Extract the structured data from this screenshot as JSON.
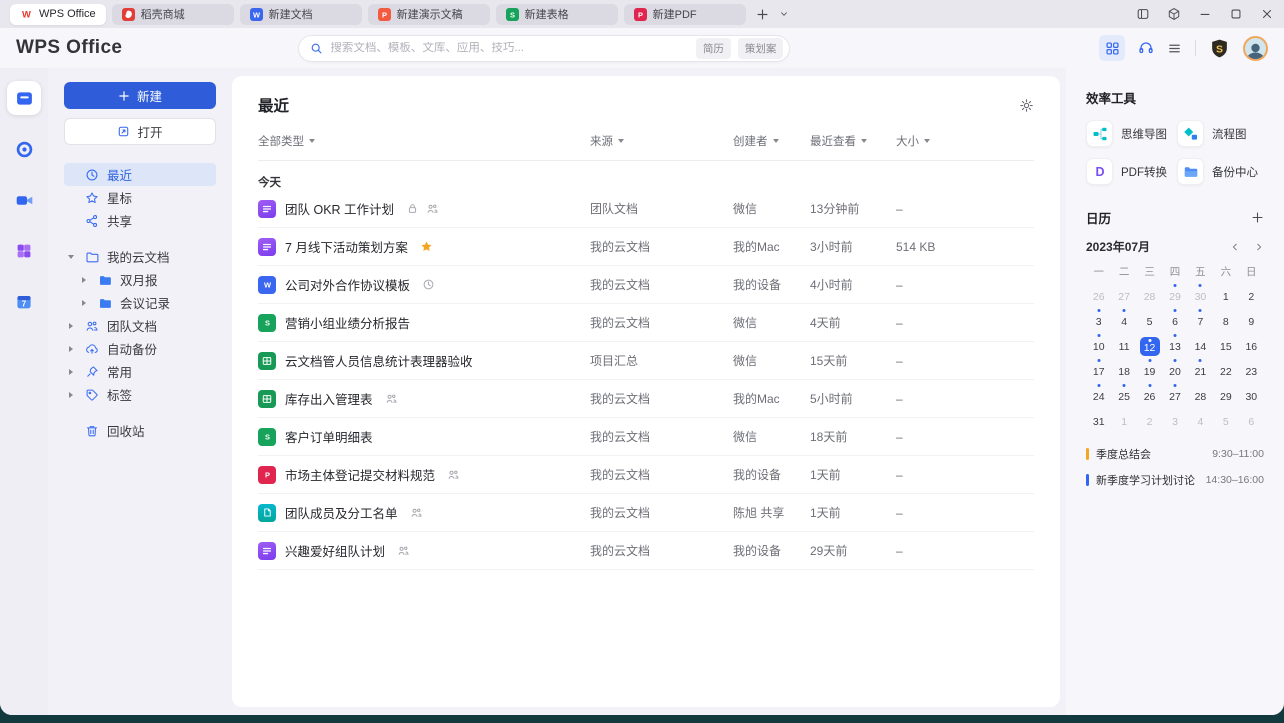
{
  "tabbar": {
    "tabs": [
      {
        "label": "WPS Office",
        "icon": "wps",
        "active": true
      },
      {
        "label": "稻壳商城",
        "icon": "docer",
        "active": false
      },
      {
        "label": "新建文档",
        "icon": "word",
        "active": false
      },
      {
        "label": "新建演示文稿",
        "icon": "ppt",
        "active": false
      },
      {
        "label": "新建表格",
        "icon": "sheet",
        "active": false
      },
      {
        "label": "新建PDF",
        "icon": "pdf",
        "active": false
      }
    ]
  },
  "header": {
    "logo": "WPS Office",
    "search": {
      "placeholder": "搜索文档、模板、文库、应用、技巧...",
      "tags": [
        "简历",
        "策划案"
      ]
    }
  },
  "sidebar": {
    "new_label": "新建",
    "open_label": "打开",
    "recent": "最近",
    "starred": "星标",
    "shared": "共享",
    "my_cloud": "我的云文档",
    "folder_bimonthly": "双月报",
    "folder_meetings": "会议记录",
    "team_docs": "团队文档",
    "auto_backup": "自动备份",
    "frequent": "常用",
    "tags_label": "标签",
    "trash": "回收站"
  },
  "main": {
    "title": "最近",
    "filters": {
      "type": "全部类型",
      "source": "来源",
      "creator": "创建者",
      "viewed": "最近查看",
      "size": "大小"
    },
    "group_today": "今天",
    "rows": [
      {
        "type": "otl",
        "name": "团队 OKR 工作计划",
        "badges": [
          "lock",
          "people"
        ],
        "source": "团队文档",
        "creator": "微信",
        "viewed": "13分钟前",
        "size": "–"
      },
      {
        "type": "otl",
        "name": "7 月线下活动策划方案",
        "badges": [
          "star"
        ],
        "source": "我的云文档",
        "creator": "我的Mac",
        "viewed": "3小时前",
        "size": "514 KB"
      },
      {
        "type": "word",
        "name": "公司对外合作协议模板",
        "badges": [
          "clock"
        ],
        "source": "我的云文档",
        "creator": "我的设备",
        "viewed": "4小时前",
        "size": "–"
      },
      {
        "type": "sheet-s",
        "name": "营销小组业绩分析报告",
        "badges": [],
        "source": "我的云文档",
        "creator": "微信",
        "viewed": "4天前",
        "size": "–"
      },
      {
        "type": "sheet-grid",
        "name": "云文档管人员信息统计表理器验收",
        "badges": [],
        "source": "项目汇总",
        "creator": "微信",
        "viewed": "15天前",
        "size": "–"
      },
      {
        "type": "sheet-grid",
        "name": "库存出入管理表",
        "badges": [
          "people"
        ],
        "source": "我的云文档",
        "creator": "我的Mac",
        "viewed": "5小时前",
        "size": "–"
      },
      {
        "type": "sheet-s",
        "name": "客户订单明细表",
        "badges": [],
        "source": "我的云文档",
        "creator": "微信",
        "viewed": "18天前",
        "size": "–"
      },
      {
        "type": "pdf",
        "name": "市场主体登记提交材料规范",
        "badges": [
          "people"
        ],
        "source": "我的云文档",
        "creator": "我的设备",
        "viewed": "1天前",
        "size": "–"
      },
      {
        "type": "smart",
        "name": "团队成员及分工名单",
        "badges": [
          "people"
        ],
        "source": "我的云文档",
        "creator": "陈旭 共享",
        "viewed": "1天前",
        "size": "–"
      },
      {
        "type": "otl",
        "name": "兴趣爱好组队计划",
        "badges": [
          "people"
        ],
        "source": "我的云文档",
        "creator": "我的设备",
        "viewed": "29天前",
        "size": "–"
      }
    ]
  },
  "tools": {
    "title": "效率工具",
    "items": [
      {
        "label": "思维导图",
        "icon": "mindmap"
      },
      {
        "label": "流程图",
        "icon": "flowchart"
      },
      {
        "label": "PDF转换",
        "icon": "pdf-convert"
      },
      {
        "label": "备份中心",
        "icon": "backup"
      }
    ]
  },
  "calendar": {
    "title": "日历",
    "month": "2023年07月",
    "weekdays": [
      "一",
      "二",
      "三",
      "四",
      "五",
      "六",
      "日"
    ],
    "weeks": [
      [
        {
          "d": 26,
          "dim": true
        },
        {
          "d": 27,
          "dim": true
        },
        {
          "d": 28,
          "dim": true
        },
        {
          "d": 29,
          "dim": true,
          "dot": true
        },
        {
          "d": 30,
          "dim": true,
          "dot": true
        },
        {
          "d": 1
        },
        {
          "d": 2
        }
      ],
      [
        {
          "d": 3,
          "dot": true
        },
        {
          "d": 4,
          "dot": true
        },
        {
          "d": 5
        },
        {
          "d": 6,
          "dot": true
        },
        {
          "d": 7,
          "dot": true
        },
        {
          "d": 8
        },
        {
          "d": 9
        }
      ],
      [
        {
          "d": 10,
          "dot": true
        },
        {
          "d": 11
        },
        {
          "d": 12,
          "today": true,
          "dot": true
        },
        {
          "d": 13,
          "dot": true
        },
        {
          "d": 14
        },
        {
          "d": 15
        },
        {
          "d": 16
        }
      ],
      [
        {
          "d": 17,
          "dot": true
        },
        {
          "d": 18
        },
        {
          "d": 19,
          "dot": true
        },
        {
          "d": 20,
          "dot": true
        },
        {
          "d": 21,
          "dot": true
        },
        {
          "d": 22
        },
        {
          "d": 23
        }
      ],
      [
        {
          "d": 24,
          "dot": true
        },
        {
          "d": 25,
          "dot": true
        },
        {
          "d": 26,
          "dot": true
        },
        {
          "d": 27,
          "dot": true
        },
        {
          "d": 28
        },
        {
          "d": 29
        },
        {
          "d": 30
        }
      ],
      [
        {
          "d": 31
        },
        {
          "d": 1,
          "dim": true
        },
        {
          "d": 2,
          "dim": true
        },
        {
          "d": 3,
          "dim": true
        },
        {
          "d": 4,
          "dim": true
        },
        {
          "d": 5,
          "dim": true
        },
        {
          "d": 6,
          "dim": true
        }
      ]
    ],
    "events": [
      {
        "label": "季度总结会",
        "time": "9:30–11:00",
        "color": "#f5a623"
      },
      {
        "label": "新季度学习计划讨论",
        "time": "14:30–16:00",
        "color": "#3366f0"
      }
    ],
    "accent": "#3366f0"
  },
  "colors": {
    "accent": "#3366f0",
    "new_button": "#2f5cd8",
    "today_fill": "#3366f0"
  }
}
